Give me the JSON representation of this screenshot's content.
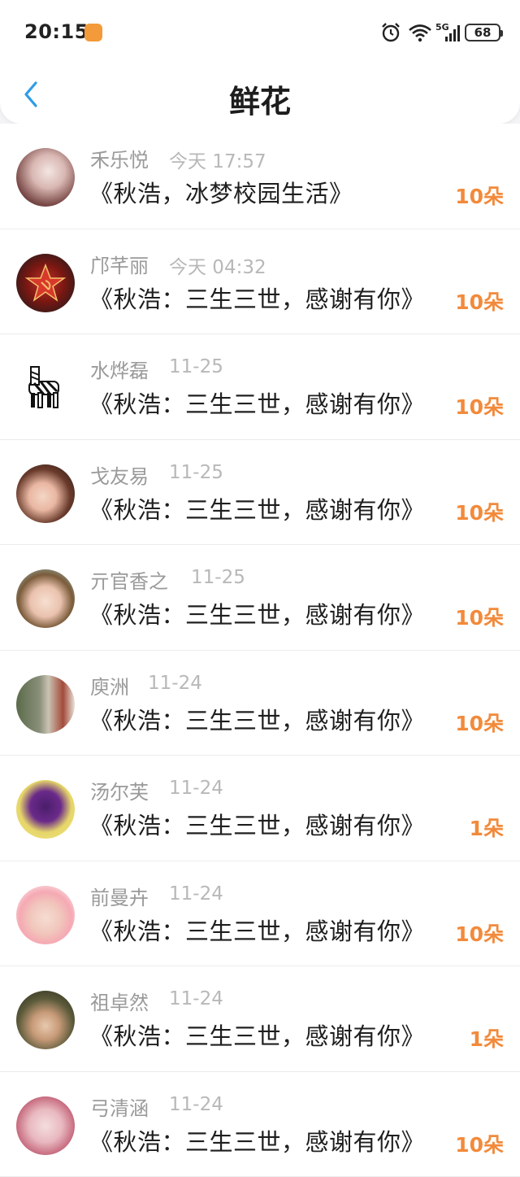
{
  "status_bar": {
    "time": "20:15",
    "network": "5G",
    "battery": "68",
    "icons": [
      "alarm-icon",
      "wifi-icon",
      "signal-icon",
      "battery-icon"
    ]
  },
  "header": {
    "title": "鲜花",
    "back_icon": "chevron-left-icon"
  },
  "colors": {
    "accent": "#f28a3b",
    "back_blue": "#2f9ce6"
  },
  "records": [
    {
      "user": "禾乐悦",
      "time": "今天 17:57",
      "book": "《秋浩，冰梦校园生活》",
      "amount": "10朵"
    },
    {
      "user": "邝芊丽",
      "time": "今天 04:32",
      "book": "《秋浩：三生三世，感谢有你》",
      "amount": "10朵"
    },
    {
      "user": "水烨磊",
      "time": "11-25",
      "book": "《秋浩：三生三世，感谢有你》",
      "amount": "10朵"
    },
    {
      "user": "戈友易",
      "time": "11-25",
      "book": "《秋浩：三生三世，感谢有你》",
      "amount": "10朵"
    },
    {
      "user": "亓官香之",
      "time": "11-25",
      "book": "《秋浩：三生三世，感谢有你》",
      "amount": "10朵"
    },
    {
      "user": "庾洲",
      "time": "11-24",
      "book": "《秋浩：三生三世，感谢有你》",
      "amount": "10朵"
    },
    {
      "user": "汤尔芙",
      "time": "11-24",
      "book": "《秋浩：三生三世，感谢有你》",
      "amount": "1朵"
    },
    {
      "user": "前曼卉",
      "time": "11-24",
      "book": "《秋浩：三生三世，感谢有你》",
      "amount": "10朵"
    },
    {
      "user": "祖卓然",
      "time": "11-24",
      "book": "《秋浩：三生三世，感谢有你》",
      "amount": "1朵"
    },
    {
      "user": "弓清涵",
      "time": "11-24",
      "book": "《秋浩：三生三世，感谢有你》",
      "amount": "10朵"
    }
  ]
}
